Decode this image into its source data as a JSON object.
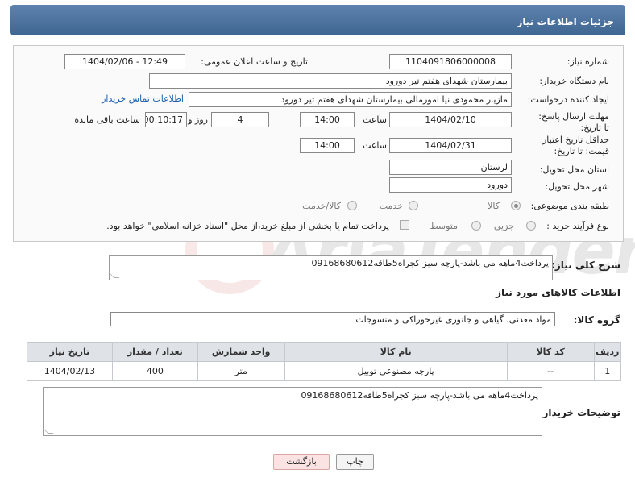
{
  "header": {
    "title": "جزئیات اطلاعات نیاز"
  },
  "form": {
    "need_number_label": "شماره نیاز:",
    "need_number": "1104091806000008",
    "announce_label": "تاریخ و ساعت اعلان عمومی:",
    "announce_value": "1404/02/06 - 12:49",
    "buyer_label": "نام دستگاه خریدار:",
    "buyer_value": "بیمارستان شهدای هفتم تیر دورود",
    "creator_label": "ایجاد کننده درخواست:",
    "creator_value": "مازیار محمودی نیا امورمالی بیمارستان شهدای هفتم تیر دورود",
    "contact_link": "اطلاعات تماس خریدار",
    "deadline_label": "مهلت ارسال پاسخ: تا تاریخ:",
    "deadline_date": "1404/02/10",
    "time_label": "ساعت",
    "deadline_time": "14:00",
    "days_value": "4",
    "days_label": "روز و",
    "remaining_value": "00:10:17",
    "remaining_label": "ساعت باقی مانده",
    "validity_label": "حداقل تاریخ اعتبار قیمت: تا تاریخ:",
    "validity_date": "1404/02/31",
    "validity_time": "14:00",
    "province_label": "استان محل تحویل:",
    "province_value": "لرستان",
    "city_label": "شهر محل تحویل:",
    "city_value": "دورود",
    "category_label": "طبقه بندی موضوعی:",
    "category_options": [
      "کالا",
      "خدمت",
      "کالا/خدمت"
    ],
    "process_label": "نوع فرآیند خرید :",
    "process_options": [
      "جزیی",
      "متوسط"
    ],
    "payment_note": "پرداخت تمام یا بخشی از مبلغ خرید،از محل \"اسناد خزانه اسلامی\" خواهد بود."
  },
  "summary": {
    "label": "شرح کلی نیاز:",
    "value": "پرداخت4ماهه می باشد-پارچه سبز کجراه5طاقه09168680612"
  },
  "goods": {
    "section_title": "اطلاعات کالاهای مورد نیاز",
    "group_label": "گروه کالا:",
    "group_value": "مواد معدنی، گیاهی و جانوری غیرخوراکی و منسوجات",
    "columns": [
      "ردیف",
      "کد کالا",
      "نام کالا",
      "واحد شمارش",
      "تعداد / مقدار",
      "تاریخ نیاز"
    ],
    "rows": [
      {
        "index": "1",
        "code": "--",
        "name": "پارچه مصنوعی توبیل",
        "unit": "متر",
        "qty": "400",
        "date": "1404/02/13"
      }
    ]
  },
  "buyer_notes": {
    "label": "توضیحات خریدار:",
    "value": "پرداخت4ماهه می باشد-پارچه سبز کجراه5طاقه09168680612"
  },
  "buttons": {
    "print": "چاپ",
    "back": "بازگشت"
  },
  "watermark": {
    "text": "AriaTender.neT"
  }
}
